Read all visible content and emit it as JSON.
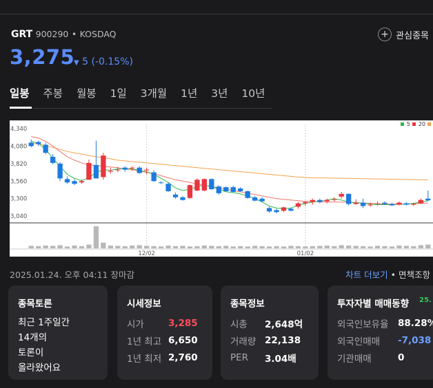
{
  "stock": {
    "ticker": "GRT",
    "code": "900290",
    "market": "KOSDAQ",
    "price": "3,275",
    "change": "5",
    "change_pct": "(-0.15%)",
    "favorite_label": "관심종목"
  },
  "tabs": [
    "일봉",
    "주봉",
    "월봉",
    "1일",
    "3개월",
    "1년",
    "3년",
    "10년"
  ],
  "chart_data": {
    "type": "candlestick",
    "y_ticks": [
      "4,340",
      "4,080",
      "3,820",
      "3,560",
      "3,300",
      "3,040"
    ],
    "ylim": [
      2950,
      4400
    ],
    "x_labels": [
      "12/02",
      "01/02"
    ],
    "legend": [
      "5",
      "20"
    ],
    "colors": {
      "up": "#e8353f",
      "down": "#1d7be0",
      "ma5": "#2fb84a",
      "ma20": "#f0746b",
      "ma60": "#f5a04a",
      "volume": "#b8b8b8"
    },
    "candles": [
      {
        "o": 4130,
        "h": 4180,
        "l": 4060,
        "c": 4080
      },
      {
        "o": 4140,
        "h": 4160,
        "l": 4080,
        "c": 4110
      },
      {
        "o": 4100,
        "h": 4130,
        "l": 3960,
        "c": 3980
      },
      {
        "o": 3920,
        "h": 3960,
        "l": 3810,
        "c": 3830
      },
      {
        "o": 3820,
        "h": 3840,
        "l": 3560,
        "c": 3600
      },
      {
        "o": 3590,
        "h": 3630,
        "l": 3520,
        "c": 3540
      },
      {
        "o": 3560,
        "h": 3590,
        "l": 3500,
        "c": 3520
      },
      {
        "o": 3540,
        "h": 3580,
        "l": 3520,
        "c": 3560
      },
      {
        "o": 3580,
        "h": 3880,
        "l": 3580,
        "c": 3830
      },
      {
        "o": 3800,
        "h": 4160,
        "l": 3600,
        "c": 3600
      },
      {
        "o": 3620,
        "h": 3980,
        "l": 3580,
        "c": 3940
      },
      {
        "o": 3700,
        "h": 3760,
        "l": 3670,
        "c": 3710
      },
      {
        "o": 3720,
        "h": 3770,
        "l": 3690,
        "c": 3730
      },
      {
        "o": 3760,
        "h": 3780,
        "l": 3700,
        "c": 3730
      },
      {
        "o": 3750,
        "h": 3780,
        "l": 3710,
        "c": 3760
      },
      {
        "o": 3760,
        "h": 3780,
        "l": 3670,
        "c": 3680
      },
      {
        "o": 3720,
        "h": 3760,
        "l": 3660,
        "c": 3730
      },
      {
        "o": 3690,
        "h": 3720,
        "l": 3550,
        "c": 3560
      },
      {
        "o": 3540,
        "h": 3560,
        "l": 3520,
        "c": 3530
      },
      {
        "o": 3520,
        "h": 3540,
        "l": 3400,
        "c": 3410
      },
      {
        "o": 3360,
        "h": 3390,
        "l": 3300,
        "c": 3320
      },
      {
        "o": 3320,
        "h": 3340,
        "l": 3270,
        "c": 3280
      },
      {
        "o": 3310,
        "h": 3510,
        "l": 3300,
        "c": 3500
      },
      {
        "o": 3420,
        "h": 3600,
        "l": 3410,
        "c": 3580
      },
      {
        "o": 3420,
        "h": 3600,
        "l": 3410,
        "c": 3590
      },
      {
        "o": 3590,
        "h": 3600,
        "l": 3430,
        "c": 3440
      },
      {
        "o": 3480,
        "h": 3500,
        "l": 3360,
        "c": 3380
      },
      {
        "o": 3470,
        "h": 3480,
        "l": 3400,
        "c": 3410
      },
      {
        "o": 3470,
        "h": 3490,
        "l": 3390,
        "c": 3400
      },
      {
        "o": 3450,
        "h": 3470,
        "l": 3400,
        "c": 3410
      },
      {
        "o": 3410,
        "h": 3420,
        "l": 3300,
        "c": 3310
      },
      {
        "o": 3320,
        "h": 3340,
        "l": 3260,
        "c": 3270
      },
      {
        "o": 3300,
        "h": 3320,
        "l": 3250,
        "c": 3260
      },
      {
        "o": 3160,
        "h": 3180,
        "l": 3090,
        "c": 3110
      },
      {
        "o": 3130,
        "h": 3150,
        "l": 3080,
        "c": 3100
      },
      {
        "o": 3120,
        "h": 3180,
        "l": 3100,
        "c": 3170
      },
      {
        "o": 3150,
        "h": 3160,
        "l": 3110,
        "c": 3120
      },
      {
        "o": 3180,
        "h": 3250,
        "l": 3150,
        "c": 3230
      },
      {
        "o": 3230,
        "h": 3260,
        "l": 3190,
        "c": 3250
      },
      {
        "o": 3250,
        "h": 3300,
        "l": 3210,
        "c": 3280
      },
      {
        "o": 3280,
        "h": 3300,
        "l": 3230,
        "c": 3250
      },
      {
        "o": 3260,
        "h": 3300,
        "l": 3230,
        "c": 3280
      },
      {
        "o": 3280,
        "h": 3320,
        "l": 3260,
        "c": 3290
      },
      {
        "o": 3330,
        "h": 3400,
        "l": 3300,
        "c": 3370
      },
      {
        "o": 3370,
        "h": 3380,
        "l": 3200,
        "c": 3220
      },
      {
        "o": 3220,
        "h": 3290,
        "l": 3210,
        "c": 3240
      },
      {
        "o": 3240,
        "h": 3300,
        "l": 3160,
        "c": 3190
      },
      {
        "o": 3200,
        "h": 3240,
        "l": 3180,
        "c": 3210
      },
      {
        "o": 3220,
        "h": 3260,
        "l": 3200,
        "c": 3230
      },
      {
        "o": 3240,
        "h": 3260,
        "l": 3210,
        "c": 3220
      },
      {
        "o": 3220,
        "h": 3240,
        "l": 3190,
        "c": 3200
      },
      {
        "o": 3210,
        "h": 3260,
        "l": 3200,
        "c": 3240
      },
      {
        "o": 3230,
        "h": 3250,
        "l": 3200,
        "c": 3210
      },
      {
        "o": 3210,
        "h": 3240,
        "l": 3190,
        "c": 3220
      },
      {
        "o": 3230,
        "h": 3300,
        "l": 3220,
        "c": 3280
      },
      {
        "o": 3300,
        "h": 3420,
        "l": 3260,
        "c": 3275
      }
    ],
    "volumes": [
      8,
      7,
      9,
      8,
      10,
      6,
      9,
      7,
      12,
      70,
      18,
      9,
      8,
      7,
      9,
      10,
      8,
      7,
      6,
      9,
      7,
      8,
      6,
      7,
      9,
      8,
      7,
      8,
      6,
      7,
      6,
      8,
      7,
      6,
      7,
      6,
      8,
      7,
      6,
      7,
      8,
      9,
      7,
      10,
      9,
      8,
      7,
      6,
      8,
      7,
      6,
      9,
      8,
      7,
      10,
      12
    ],
    "ma5": [
      4150,
      4120,
      4030,
      3900,
      3780,
      3660,
      3600,
      3570,
      3610,
      3690,
      3730,
      3720,
      3740,
      3750,
      3740,
      3720,
      3700,
      3660,
      3600,
      3540,
      3460,
      3420,
      3440,
      3480,
      3500,
      3480,
      3440,
      3400,
      3390,
      3370,
      3340,
      3300,
      3250,
      3190,
      3160,
      3150,
      3160,
      3200,
      3230,
      3250,
      3260,
      3280,
      3300,
      3280,
      3250,
      3240,
      3230,
      3220,
      3210,
      3210,
      3210,
      3215,
      3220,
      3230,
      3250,
      3270
    ],
    "ma20": [
      4220,
      4200,
      4150,
      4080,
      4000,
      3920,
      3870,
      3830,
      3800,
      3790,
      3780,
      3770,
      3760,
      3740,
      3730,
      3710,
      3690,
      3670,
      3640,
      3610,
      3580,
      3560,
      3540,
      3520,
      3500,
      3480,
      3460,
      3440,
      3420,
      3400,
      3380,
      3360,
      3340,
      3320,
      3300,
      3290,
      3280,
      3270,
      3260,
      3260,
      3250,
      3250,
      3250,
      3250,
      3245,
      3240,
      3235,
      3230,
      3225,
      3220,
      3220,
      3220,
      3220,
      3225,
      3230,
      3235
    ],
    "ma60": [
      4120,
      4110,
      4090,
      4060,
      4030,
      4000,
      3980,
      3960,
      3940,
      3920,
      3910,
      3890,
      3870,
      3860,
      3850,
      3840,
      3830,
      3820,
      3810,
      3800,
      3790,
      3780,
      3770,
      3760,
      3750,
      3740,
      3730,
      3720,
      3710,
      3700,
      3690,
      3680,
      3670,
      3660,
      3650,
      3640,
      3630,
      3620,
      3615,
      3610,
      3608,
      3606,
      3604,
      3602,
      3600,
      3598,
      3596,
      3594,
      3592,
      3590,
      3588,
      3586,
      3584,
      3582,
      3580,
      3578
    ]
  },
  "timestamp": "2025.01.24. 오후 04:11 장마감",
  "chart_more": "차트 더보기",
  "disclaimer": "• 면책조항",
  "cards": {
    "discussion": {
      "title": "종목토론",
      "lines": [
        "최근 1주일간",
        "14개의",
        "토론이",
        "올라왔어요"
      ]
    },
    "quote": {
      "title": "시세정보",
      "rows": [
        {
          "k": "시가",
          "v": "3,285"
        },
        {
          "k": "1년 최고",
          "v": "6,650"
        },
        {
          "k": "1년 최저",
          "v": "2,760"
        }
      ]
    },
    "info": {
      "title": "종목정보",
      "rows": [
        {
          "k": "시총",
          "v": "2,648억"
        },
        {
          "k": "거래량",
          "v": "22,138"
        },
        {
          "k": "PER",
          "v": "3.04배"
        }
      ]
    },
    "investor": {
      "title": "투자자별 매매동향",
      "badge": "25.",
      "rows": [
        {
          "k": "외국인보유율",
          "v": "88.28%"
        },
        {
          "k": "외국인매매",
          "v": "-7,038"
        },
        {
          "k": "기관매매",
          "v": "0"
        }
      ]
    }
  }
}
